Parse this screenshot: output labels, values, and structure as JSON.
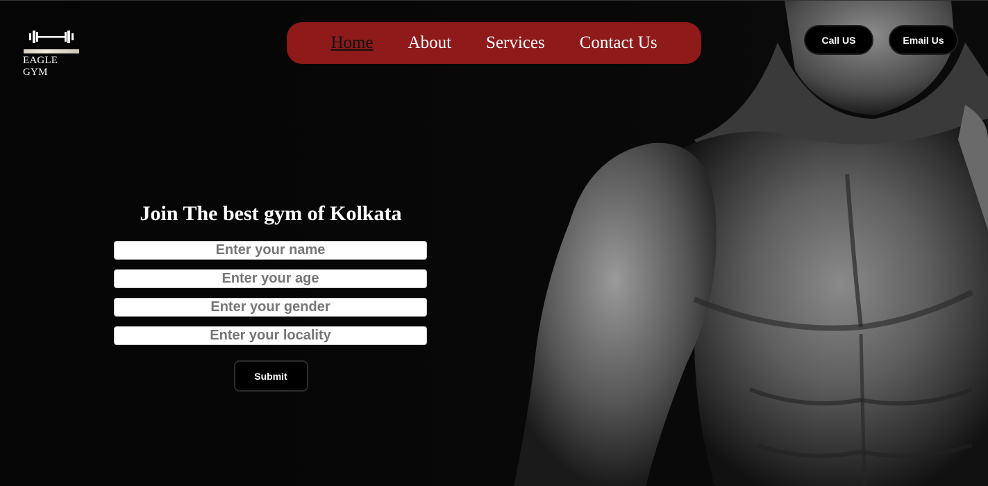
{
  "brand": {
    "name": "EAGLE GYM",
    "logo_icon": "dumbbell-icon"
  },
  "nav": {
    "items": [
      {
        "label": "Home",
        "active": true
      },
      {
        "label": "About",
        "active": false
      },
      {
        "label": "Services",
        "active": false
      },
      {
        "label": "Contact Us",
        "active": false
      }
    ]
  },
  "header_actions": {
    "call_label": "Call US",
    "email_label": "Email Us"
  },
  "form": {
    "title": "Join The best gym of Kolkata",
    "fields": [
      {
        "placeholder": "Enter your name",
        "value": ""
      },
      {
        "placeholder": "Enter your age",
        "value": ""
      },
      {
        "placeholder": "Enter your gender",
        "value": ""
      },
      {
        "placeholder": "Enter your locality",
        "value": ""
      }
    ],
    "submit_label": "Submit"
  },
  "colors": {
    "background": "#000000",
    "nav_background": "#8e1a1a",
    "text": "#ffffff",
    "active_nav_text": "#111111"
  }
}
